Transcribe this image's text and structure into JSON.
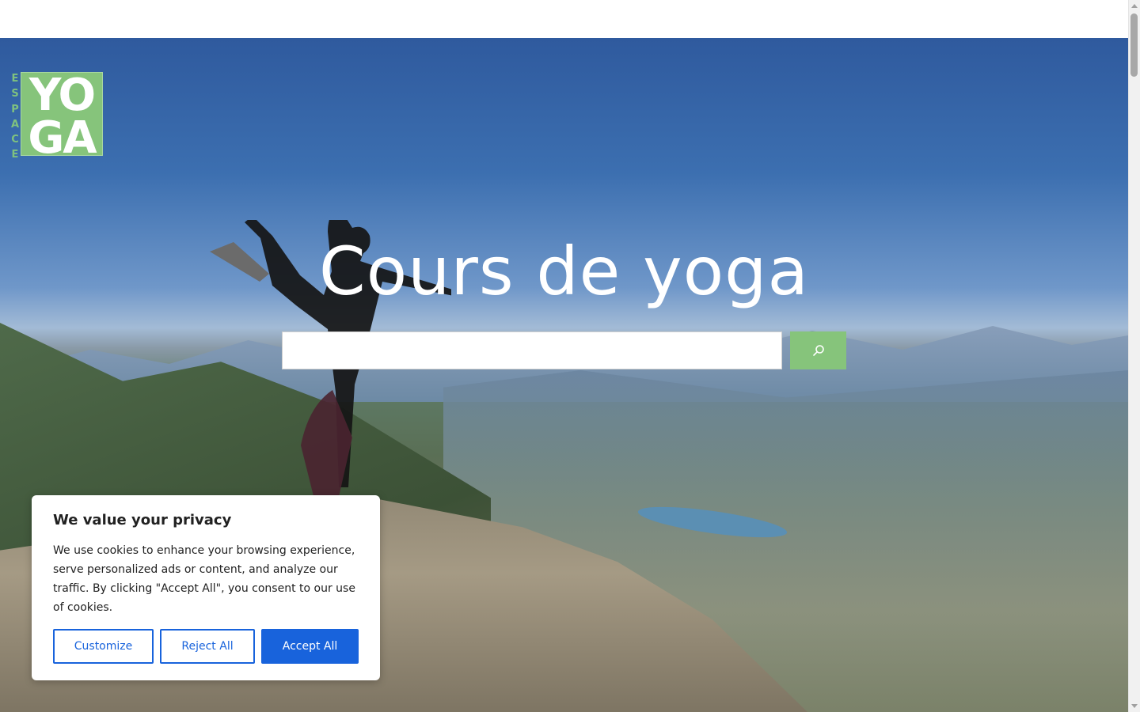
{
  "logo": {
    "side_letters": [
      "E",
      "S",
      "P",
      "A",
      "C",
      "E"
    ],
    "line1": "YO",
    "line2": "GA",
    "color": "#86c47b"
  },
  "hero": {
    "title": "Cours de yoga",
    "image": "yoga-pose-on-mountain-summit"
  },
  "search": {
    "value": "",
    "placeholder": "",
    "button_icon": "search-icon",
    "button_color": "#86c47b"
  },
  "cookie_banner": {
    "title": "We value your privacy",
    "text": "We use cookies to enhance your browsing experience, serve personalized ads or content, and analyze our traffic. By clicking \"Accept All\", you consent to our use of cookies.",
    "buttons": {
      "customize": "Customize",
      "reject": "Reject All",
      "accept": "Accept All"
    },
    "accent_color": "#1863dc"
  }
}
